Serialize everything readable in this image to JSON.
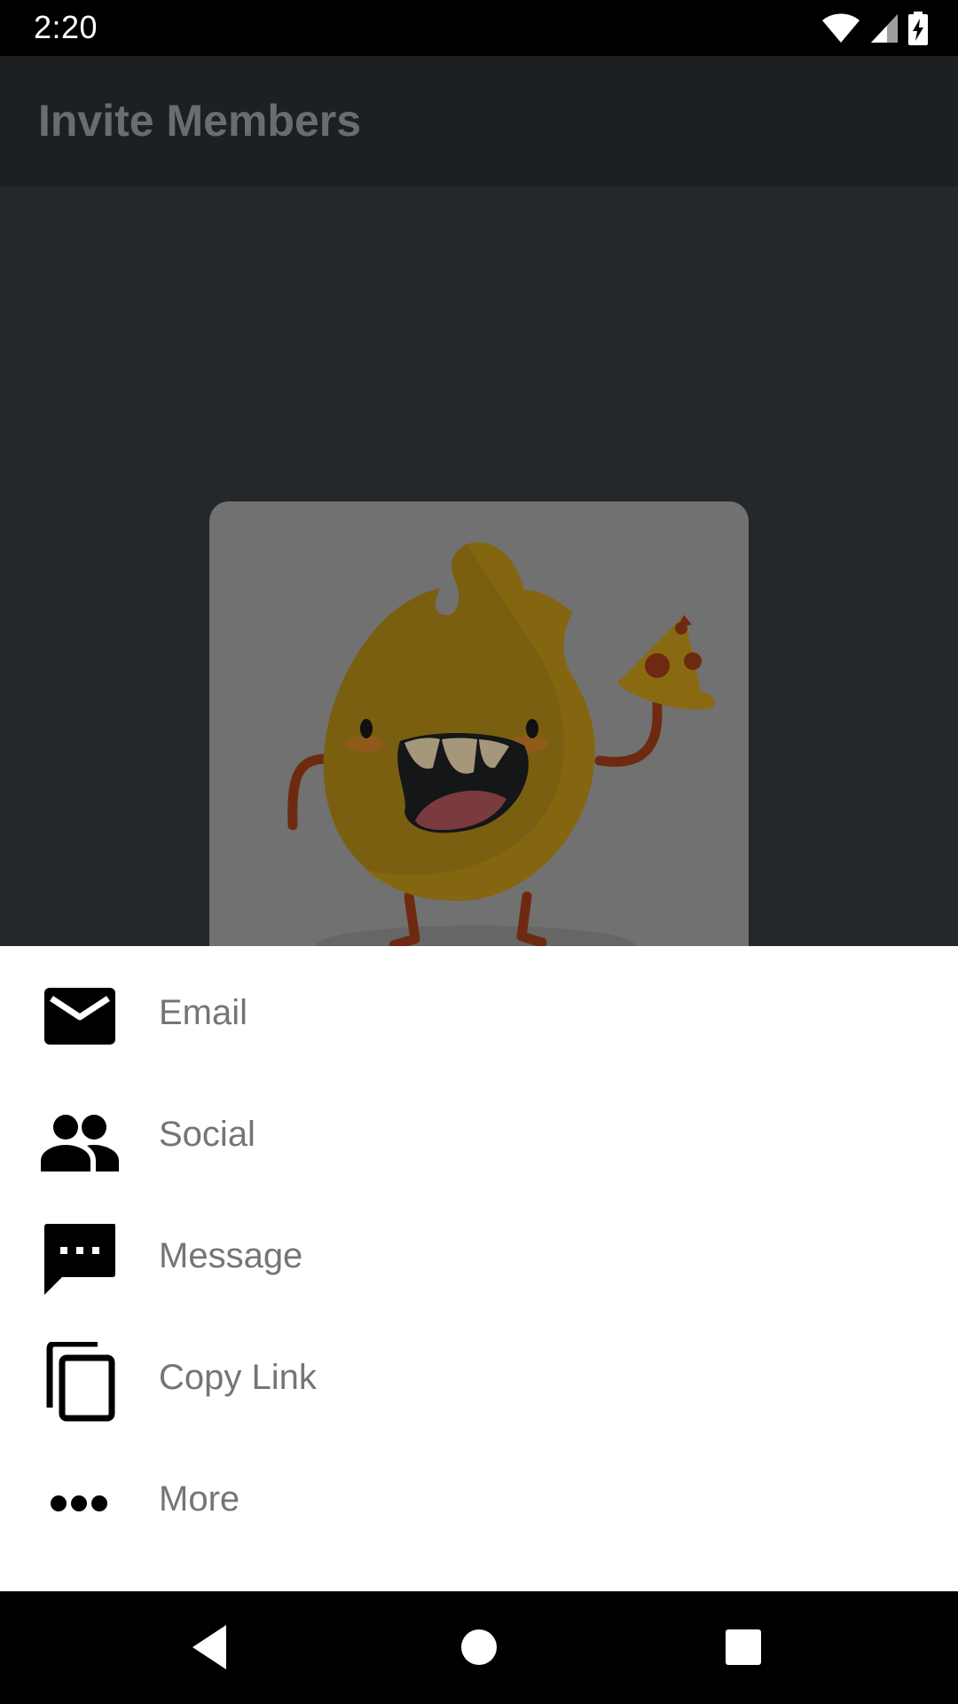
{
  "status_bar": {
    "time": "2:20",
    "icons": [
      "wifi-icon",
      "cell-signal-icon",
      "battery-charging-icon"
    ]
  },
  "app_bar": {
    "title": "Invite Members"
  },
  "content": {
    "card_image": "fire-mascot-with-pizza-illustration"
  },
  "share_sheet": {
    "items": [
      {
        "label": "Email",
        "icon": "email-icon"
      },
      {
        "label": "Social",
        "icon": "people-icon"
      },
      {
        "label": "Message",
        "icon": "message-icon"
      },
      {
        "label": "Copy Link",
        "icon": "copy-icon"
      },
      {
        "label": "More",
        "icon": "more-horizontal-icon"
      }
    ]
  },
  "nav_bar": {
    "buttons": [
      "back-icon",
      "home-icon",
      "recents-icon"
    ]
  },
  "colors": {
    "status_bar_bg": "#000000",
    "app_bar_bg": "#1d2022",
    "content_bg": "#25282b",
    "sheet_bg": "#ffffff",
    "sheet_label": "#757575",
    "icon": "#000000"
  }
}
